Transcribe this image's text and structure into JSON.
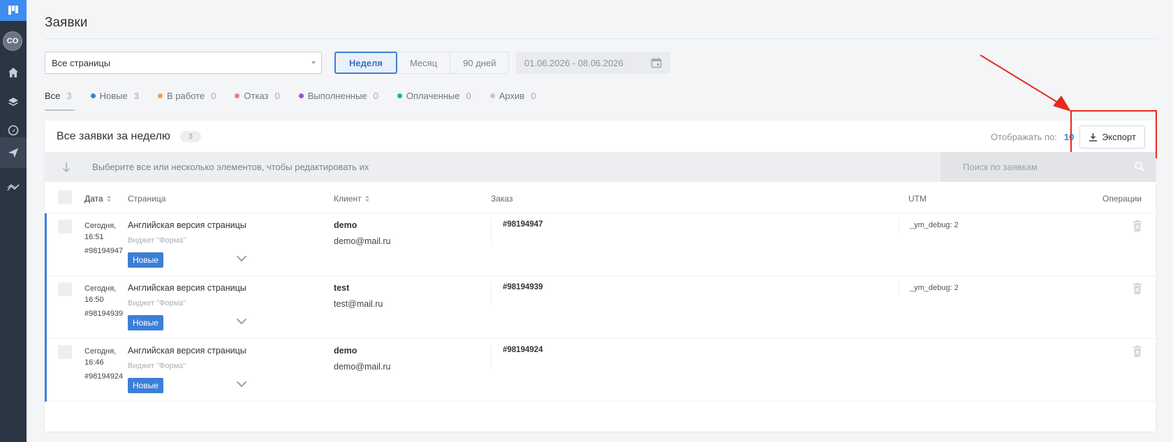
{
  "sidebar": {
    "avatar": "CO",
    "items": [
      {
        "icon": "home-icon"
      },
      {
        "icon": "layers-icon"
      },
      {
        "icon": "rocket-icon"
      },
      {
        "icon": "send-icon",
        "active": true
      },
      {
        "icon": "trend-icon"
      }
    ]
  },
  "header": {
    "title": "Заявки"
  },
  "filters": {
    "page_select": "Все страницы",
    "periods": [
      "Неделя",
      "Месяц",
      "90 дней"
    ],
    "active_period": "Неделя",
    "date_range": "01.06.2026 - 08.06.2026"
  },
  "tabs": [
    {
      "label": "Все",
      "count": "3",
      "color": "",
      "active": true
    },
    {
      "label": "Новые",
      "count": "3",
      "color": "#3d7fd6"
    },
    {
      "label": "В работе",
      "count": "0",
      "color": "#f0a04b"
    },
    {
      "label": "Отказ",
      "count": "0",
      "color": "#ee7a7a"
    },
    {
      "label": "Выполненные",
      "count": "0",
      "color": "#9b4fe0"
    },
    {
      "label": "Оплаченные",
      "count": "0",
      "color": "#1ab3a3"
    },
    {
      "label": "Архив",
      "count": "0",
      "color": "#c3c7cd"
    }
  ],
  "card": {
    "title": "Все заявки за неделю",
    "count": "3",
    "per_page_label": "Отображать по:",
    "per_page_value": "10",
    "export_label": "Экспорт",
    "bulk_hint": "Выберите все или несколько элементов, чтобы редактировать их",
    "search_placeholder": "Поиск по заявкам"
  },
  "columns": {
    "date": "Дата",
    "page": "Страница",
    "client": "Клиент",
    "order": "Заказ",
    "utm": "UTM",
    "ops": "Операции"
  },
  "rows": [
    {
      "date": "Сегодня, 16:51",
      "id": "#98194947",
      "page": "Английская версия страницы",
      "widget": "Виджет \"Форма\"",
      "status": "Новые",
      "client_name": "demo",
      "client_email": "demo@mail.ru",
      "order": "#98194947",
      "utm": "_ym_debug: 2"
    },
    {
      "date": "Сегодня, 16:50",
      "id": "#98194939",
      "page": "Английская версия страницы",
      "widget": "Виджет \"Форма\"",
      "status": "Новые",
      "client_name": "test",
      "client_email": "test@mail.ru",
      "order": "#98194939",
      "utm": "_ym_debug: 2"
    },
    {
      "date": "Сегодня, 16:46",
      "id": "#98194924",
      "page": "Английская версия страницы",
      "widget": "Виджет \"Форма\"",
      "status": "Новые",
      "client_name": "demo",
      "client_email": "demo@mail.ru",
      "order": "#98194924",
      "utm": ""
    }
  ],
  "colors": {
    "accent": "#3d7fd6",
    "sidebar": "#2b3544",
    "annotation": "#e8291c"
  }
}
